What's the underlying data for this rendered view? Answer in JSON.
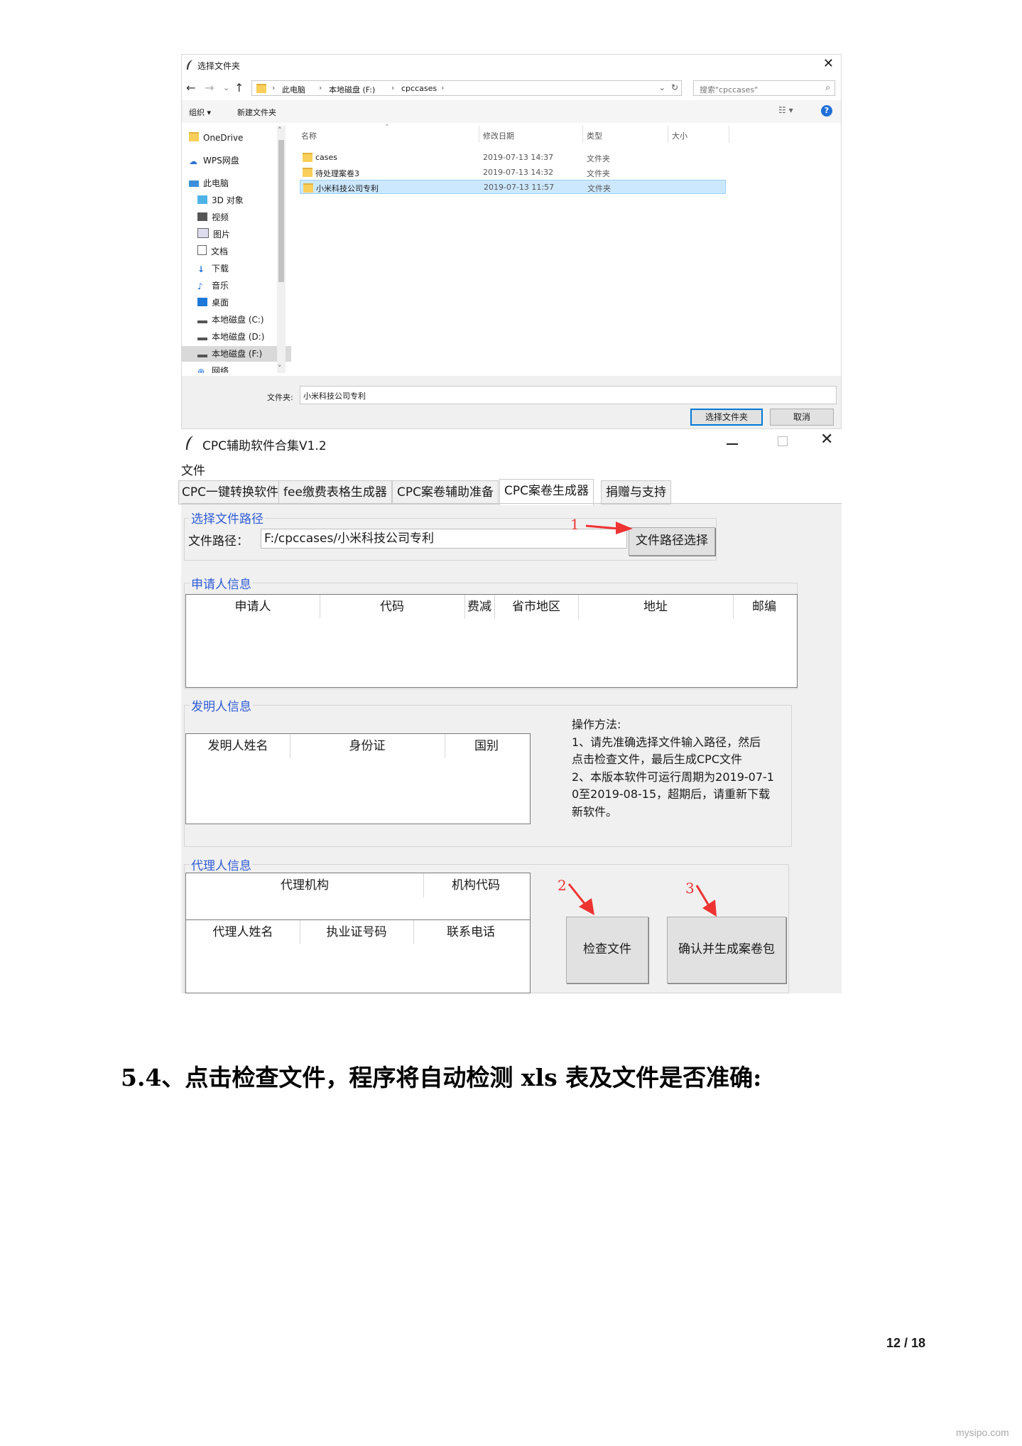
{
  "dialog": {
    "title": "选择文件夹",
    "breadcrumb": [
      "此电脑",
      "本地磁盘 (F:)",
      "cpccases"
    ],
    "search_placeholder": "搜索\"cpccases\"",
    "toolbar": {
      "organize": "组织 ▾",
      "new_folder": "新建文件夹"
    },
    "sidebar": [
      {
        "label": "OneDrive",
        "icon": "folder-icon"
      },
      {
        "label": "WPS网盘",
        "icon": "cloud-icon"
      },
      {
        "label": "此电脑",
        "icon": "computer-icon"
      },
      {
        "label": "3D 对象",
        "icon": "cube-icon"
      },
      {
        "label": "视频",
        "icon": "video-icon"
      },
      {
        "label": "图片",
        "icon": "picture-icon"
      },
      {
        "label": "文档",
        "icon": "document-icon"
      },
      {
        "label": "下载",
        "icon": "download-icon"
      },
      {
        "label": "音乐",
        "icon": "music-icon"
      },
      {
        "label": "桌面",
        "icon": "desktop-icon"
      },
      {
        "label": "本地磁盘 (C:)",
        "icon": "drive-icon"
      },
      {
        "label": "本地磁盘 (D:)",
        "icon": "drive-icon"
      },
      {
        "label": "本地磁盘 (F:)",
        "icon": "drive-icon"
      },
      {
        "label": "网络",
        "icon": "network-icon"
      }
    ],
    "columns": [
      "名称",
      "修改日期",
      "类型",
      "大小"
    ],
    "files": [
      {
        "name": "cases",
        "date": "2019-07-13 14:37",
        "type": "文件夹"
      },
      {
        "name": "待处理案卷3",
        "date": "2019-07-13 14:32",
        "type": "文件夹"
      },
      {
        "name": "小米科技公司专利",
        "date": "2019-07-13 11:57",
        "type": "文件夹"
      }
    ],
    "folder_label": "文件夹:",
    "folder_value": "小米科技公司专利",
    "ok_button": "选择文件夹",
    "cancel_button": "取消"
  },
  "app": {
    "title": "CPC辅助软件合集V1.2",
    "menu_file": "文件",
    "tabs": [
      "CPC一键转换软件",
      "fee缴费表格生成器",
      "CPC案卷辅助准备",
      "CPC案卷生成器",
      "捐赠与支持"
    ],
    "path_group": "选择文件路径",
    "path_label": "文件路径：",
    "path_value": "F:/cpccases/小米科技公司专利",
    "path_button": "文件路径选择",
    "applicant_group": "申请人信息",
    "applicant_cols": [
      "申请人",
      "代码",
      "费减",
      "省市地区",
      "地址",
      "邮编"
    ],
    "inventor_group": "发明人信息",
    "inventor_cols": [
      "发明人姓名",
      "身份证",
      "国别"
    ],
    "instructions": [
      "操作方法:",
      "1、请先准确选择文件输入路径，然后",
      "点击检查文件，最后生成CPC文件",
      "2、本版本软件可运行周期为2019-07-1",
      "0至2019-08-15，超期后，请重新下载",
      "新软件。"
    ],
    "agent_group": "代理人信息",
    "agency_cols": [
      "代理机构",
      "机构代码"
    ],
    "agent_cols": [
      "代理人姓名",
      "执业证号码",
      "联系电话"
    ],
    "check_button": "检查文件",
    "generate_button": "确认并生成案卷包",
    "markers": [
      "1",
      "2",
      "3"
    ]
  },
  "heading": "5.4、点击检查文件，程序将自动检测 xls 表及文件是否准确:",
  "page_number": "12 / 18",
  "watermark": "mysipo.com",
  "colors": {
    "accent_blue": "#2e5bd6",
    "arrow_red": "#e33333",
    "selection": "#cce8ff"
  }
}
